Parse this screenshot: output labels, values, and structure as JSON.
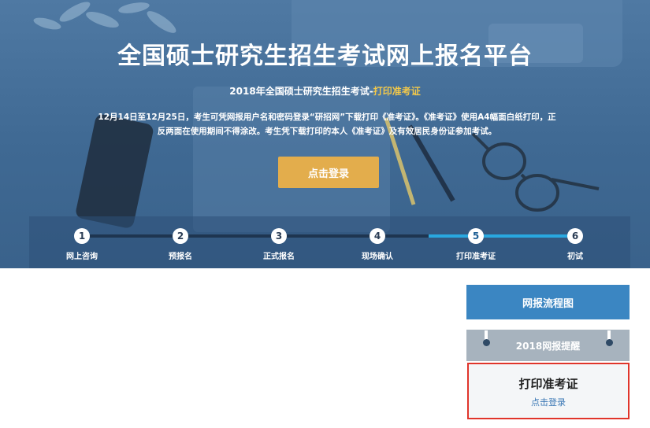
{
  "hero": {
    "title": "全国硕士研究生招生考试网上报名平台",
    "subtitle_main": "2018年全国硕士研究生招生考试-",
    "subtitle_highlight": "打印准考证",
    "description": "12月14日至12月25日，考生可凭网报用户名和密码登录“研招网”下载打印《准考证》。《准考证》使用A4幅面白纸打印，正反两面在使用期间不得涂改。考生凭下载打印的本人《准考证》及有效居民身份证参加考试。",
    "login_button": "点击登录"
  },
  "steps": [
    {
      "number": "1",
      "label": "网上咨询"
    },
    {
      "number": "2",
      "label": "预报名"
    },
    {
      "number": "3",
      "label": "正式报名"
    },
    {
      "number": "4",
      "label": "现场确认"
    },
    {
      "number": "5",
      "label": "打印准考证"
    },
    {
      "number": "6",
      "label": "初试"
    }
  ],
  "active_step_index": 4,
  "sidebar": {
    "flow_button": "网报流程图",
    "reminder_label": "2018网报提醒",
    "card_title": "打印准考证",
    "card_link": "点击登录"
  },
  "colors": {
    "hero_bg": "#426c96",
    "accent_gold": "#e3ad4c",
    "highlight_yellow": "#f2c84a",
    "step_done": "#1e3550",
    "step_active": "#29a8e0",
    "flow_button": "#3b86c2",
    "reminder_bg": "#a7b3be",
    "card_border": "#e0352b",
    "link_blue": "#3b78b5"
  }
}
